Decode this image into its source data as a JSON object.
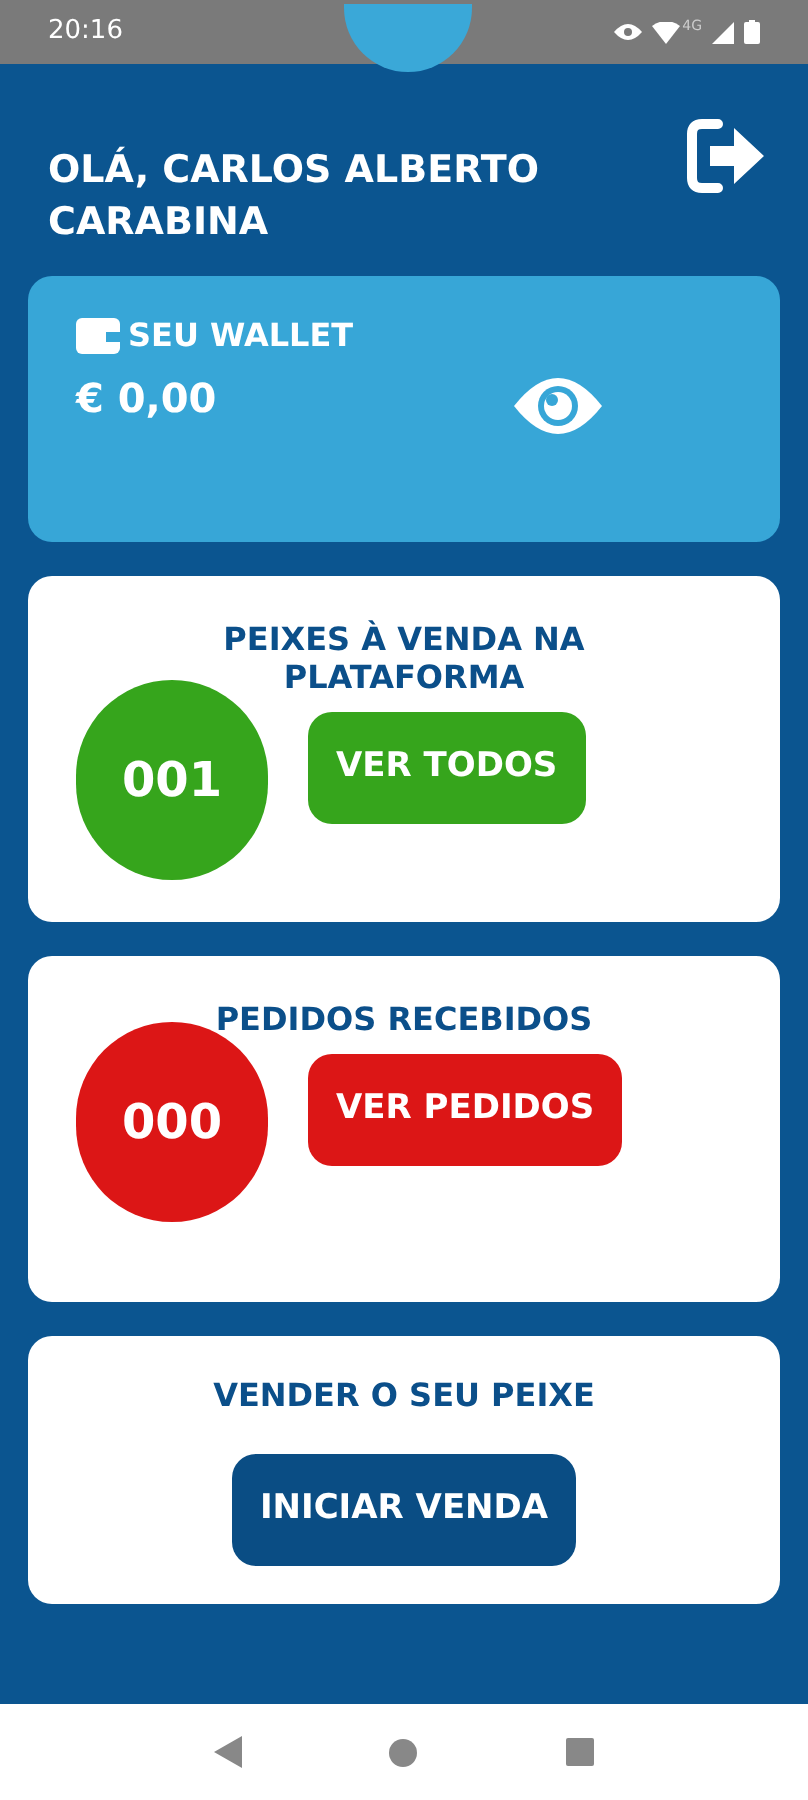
{
  "status_bar": {
    "time": "20:16",
    "network": "4G"
  },
  "header": {
    "greeting": "OLÁ, CARLOS ALBERTO CARABINA"
  },
  "wallet": {
    "title": "SEU WALLET",
    "balance": "€ 0,00"
  },
  "cards": [
    {
      "kind": "counter",
      "title": "PEIXES À VENDA NA PLATAFORMA",
      "count": "001",
      "button": "VER TODOS",
      "color": "#36a51c"
    },
    {
      "kind": "counter",
      "title": "PEDIDOS RECEBIDOS",
      "count": "000",
      "button": "VER PEDIDOS",
      "color": "#dc1616"
    },
    {
      "kind": "action",
      "title": "VENDER O SEU PEIXE",
      "button": "INICIAR VENDA",
      "color": "#0a4d84"
    }
  ]
}
